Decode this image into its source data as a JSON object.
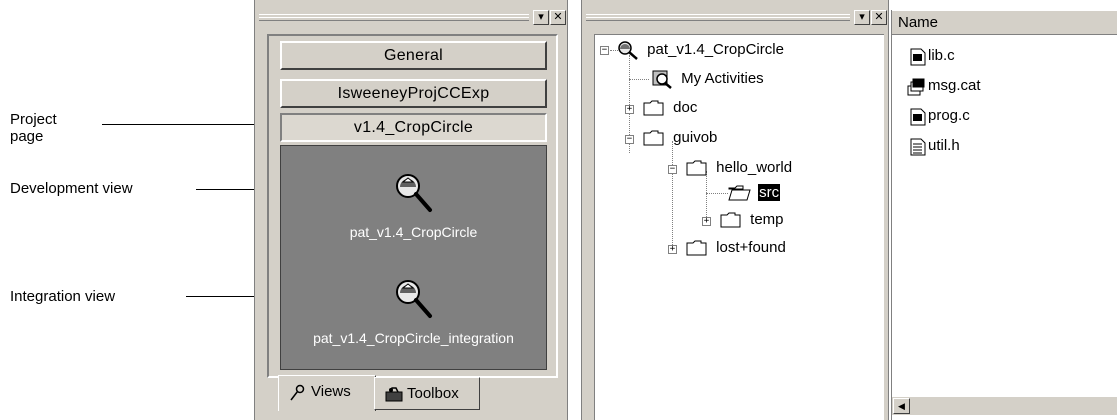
{
  "callouts": {
    "project_page": "Project\npage",
    "development_view": "Development view",
    "integration_view": "Integration view"
  },
  "views_panel": {
    "project_buttons": [
      "General",
      "IsweeneyProjCCExp",
      "v1.4_CropCircle"
    ],
    "selected_project": "v1.4_CropCircle",
    "views": [
      {
        "label": "pat_v1.4_CropCircle",
        "icon": "view-magnifier-icon"
      },
      {
        "label": "pat_v1.4_CropCircle_integration",
        "icon": "view-magnifier-icon"
      }
    ],
    "tabs": [
      {
        "label": "Views",
        "icon": "wand-icon"
      },
      {
        "label": "Toolbox",
        "icon": "toolbox-icon"
      }
    ]
  },
  "tree": {
    "root": "pat_v1.4_CropCircle",
    "nodes": {
      "my_activities": "My Activities",
      "doc": "doc",
      "guivob": "guivob",
      "hello_world": "hello_world",
      "src": "src",
      "temp": "temp",
      "lost_found": "lost+found"
    },
    "selected": "src"
  },
  "file_list": {
    "column_header": "Name",
    "files": [
      {
        "name": "lib.c",
        "icon": "c-source-icon"
      },
      {
        "name": "msg.cat",
        "icon": "catalog-icon"
      },
      {
        "name": "prog.c",
        "icon": "c-source-icon"
      },
      {
        "name": "util.h",
        "icon": "header-file-icon"
      }
    ]
  },
  "colors": {
    "window_face": "#d4d0c8",
    "dark_view_area": "#808080",
    "selection": "#000000"
  }
}
